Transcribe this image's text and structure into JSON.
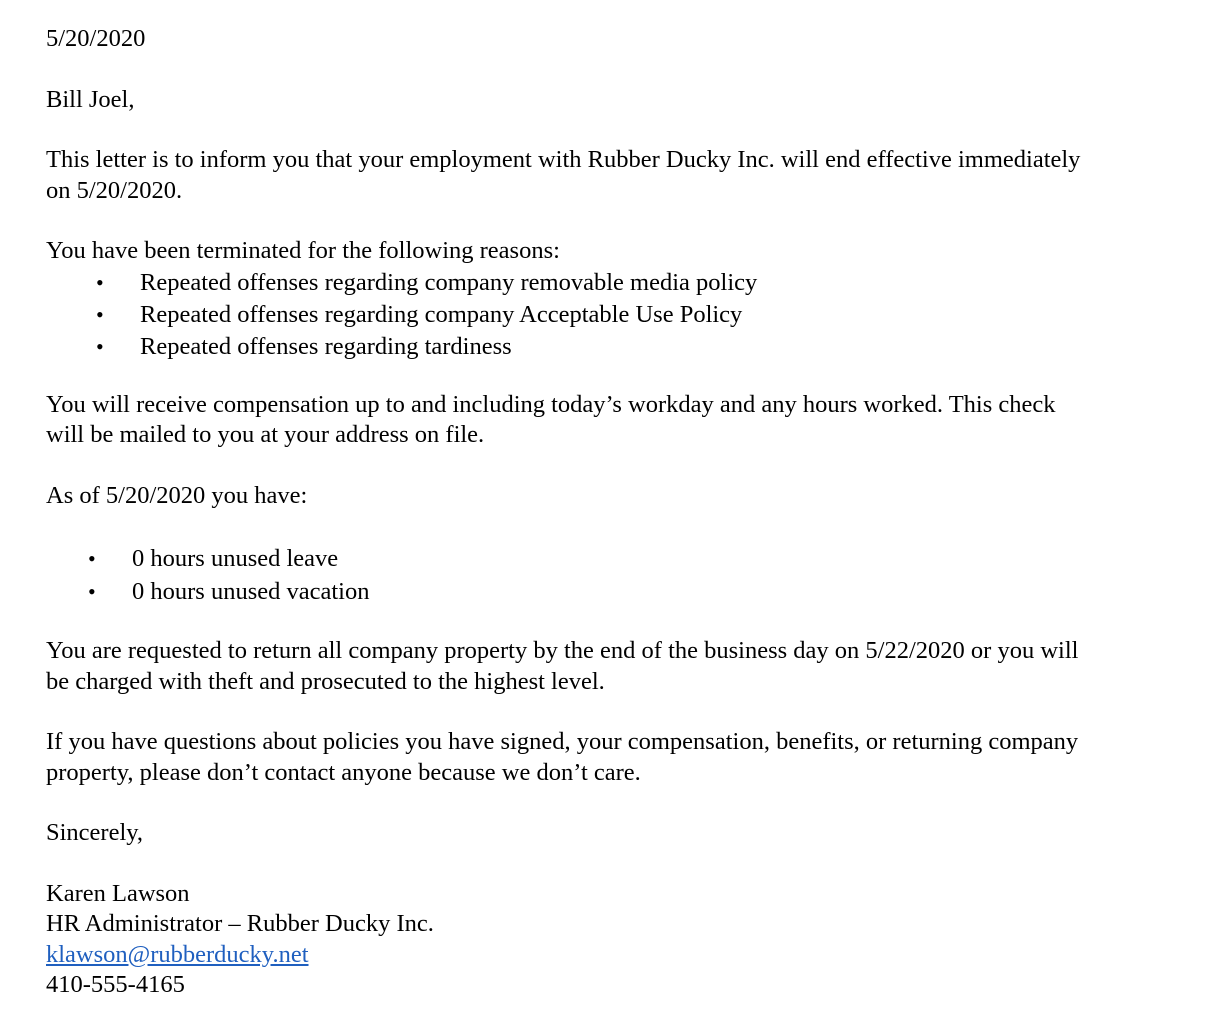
{
  "letter": {
    "date": "5/20/2020",
    "salutation": "Bill Joel,",
    "intro_line1": "This letter is to inform you that your employment with Rubber Ducky Inc. will end effective immediately",
    "intro_line2": "on 5/20/2020.",
    "reasons_heading": "You have been terminated for the following reasons:",
    "reasons": [
      "Repeated offenses regarding company removable media policy",
      "Repeated offenses regarding company Acceptable Use Policy",
      "Repeated offenses regarding tardiness"
    ],
    "compensation_line1": "You will receive compensation up to and including today’s workday and any hours worked.  This check",
    "compensation_line2": "will be mailed to you at your address on file.",
    "balance_heading": "As of 5/20/2020 you have:",
    "balances": [
      "0 hours unused leave",
      "0 hours unused vacation"
    ],
    "property_line1": "You are requested to return all company property by the end of the business day on 5/22/2020 or you will",
    "property_line2": "be charged with theft and prosecuted to the highest level.",
    "questions_line1": "If you have questions about policies you have signed, your compensation, benefits, or returning company",
    "questions_line2": "property, please don’t contact anyone because we don’t care.",
    "closing": "Sincerely,",
    "signer_name": "Karen Lawson",
    "signer_title": "HR Administrator – Rubber Ducky Inc.",
    "signer_email": "klawson@rubberducky.net",
    "signer_phone": "410-555-4165",
    "bullet_glyph": "•"
  },
  "colors": {
    "text": "#000000",
    "link": "#1f5fbf",
    "background": "#ffffff"
  }
}
